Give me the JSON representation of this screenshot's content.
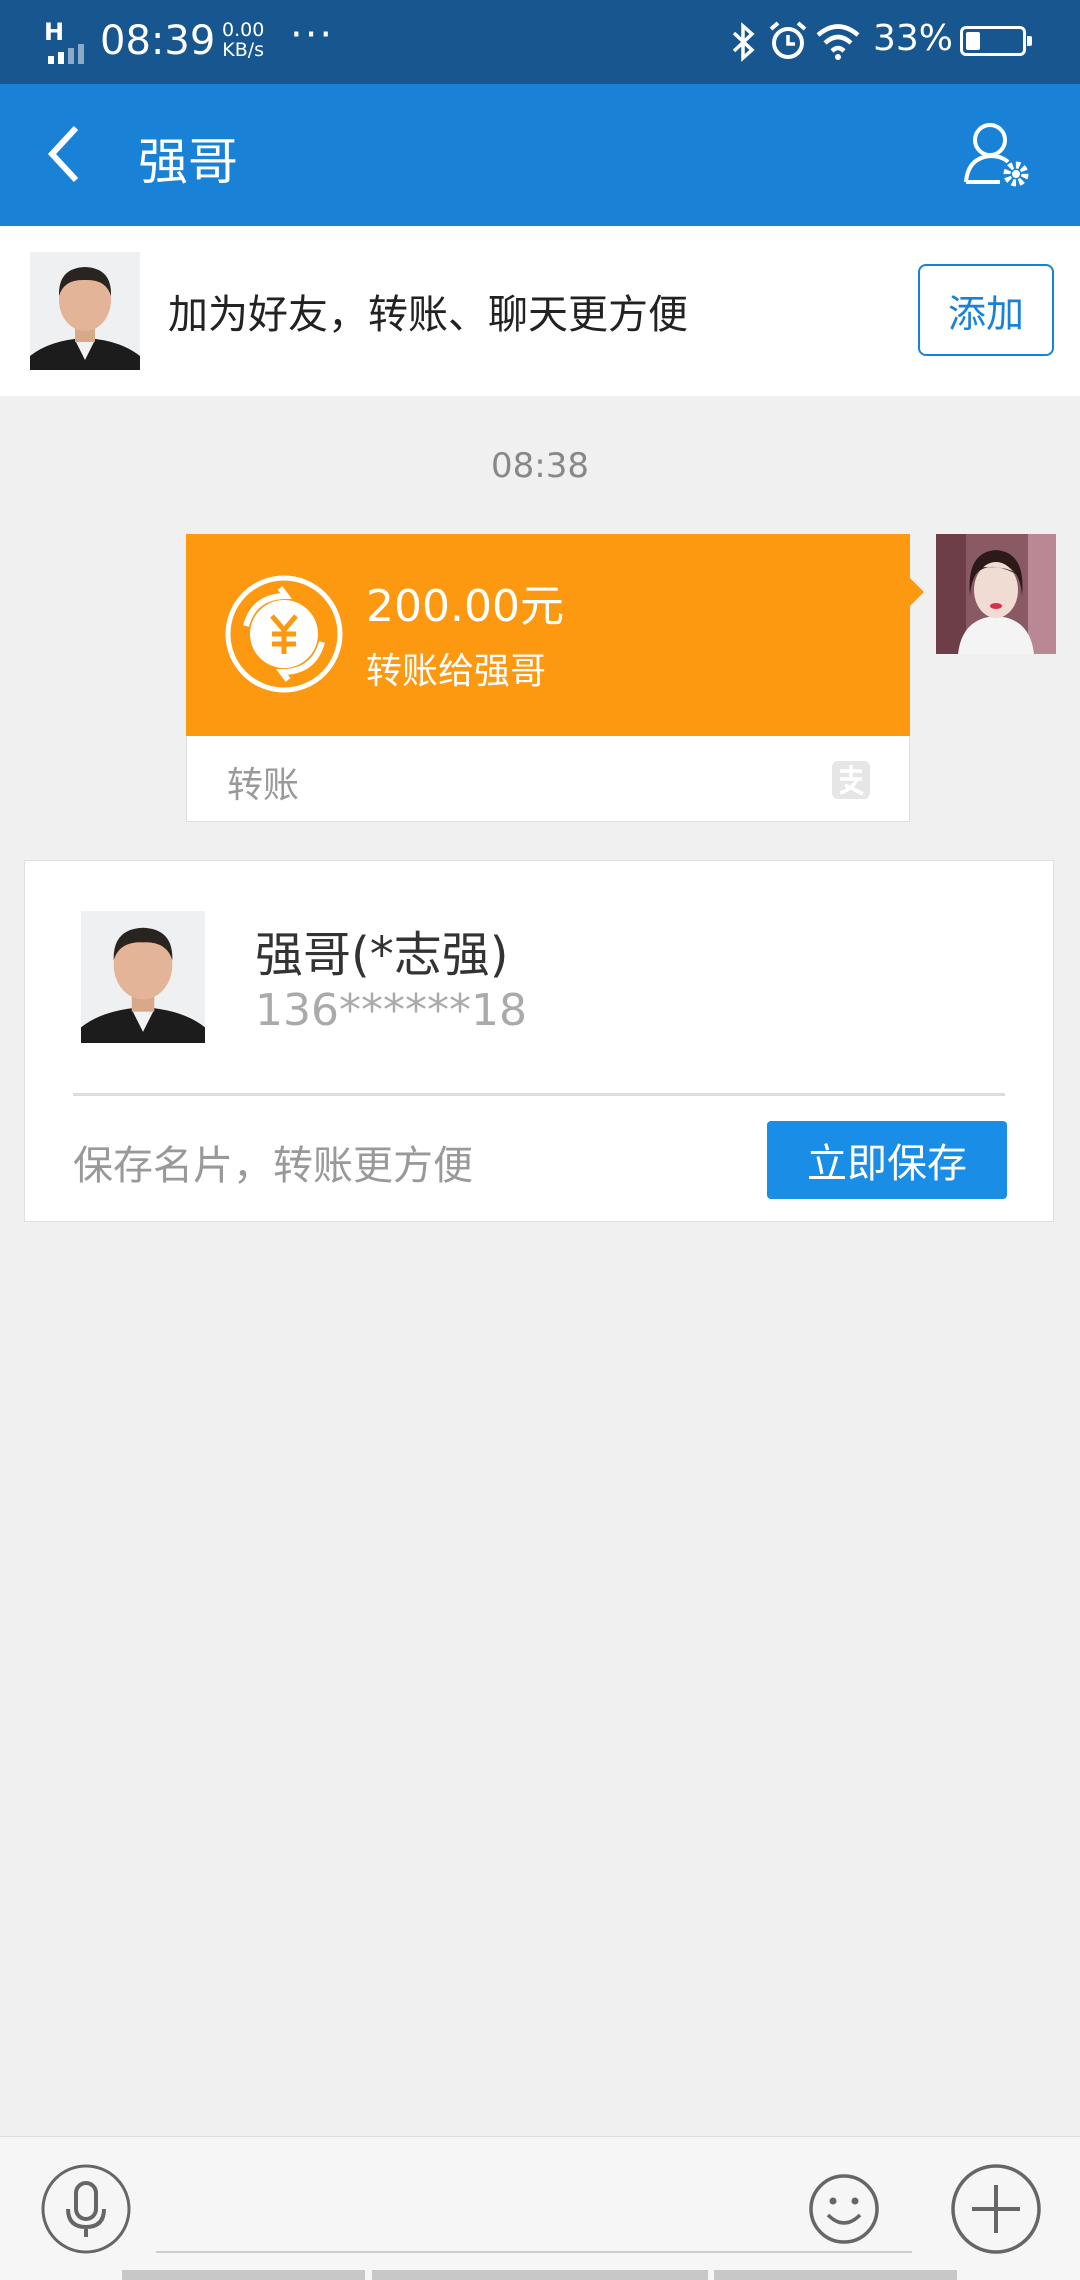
{
  "status_bar": {
    "network_type": "H",
    "time": "08:39",
    "speed_value": "0.00",
    "speed_unit": "KB/s",
    "more": "···",
    "battery_percent": "33%",
    "battery_level": 0.33,
    "icons": [
      "signal-icon",
      "bluetooth-icon",
      "alarm-icon",
      "wifi-icon",
      "battery-icon"
    ]
  },
  "nav": {
    "title": "强哥",
    "back_icon": "chevron-left-icon",
    "settings_icon": "person-settings-icon"
  },
  "add_banner": {
    "prompt": "加为好友，转账、聊天更方便",
    "add_label": "添加"
  },
  "chat": {
    "timestamp": "08:38",
    "transfer": {
      "amount": "200.00元",
      "description": "转账给强哥",
      "type_label": "转账",
      "icon": "yuan-transfer-icon",
      "brand_icon": "alipay-icon"
    }
  },
  "contact_card": {
    "name": "强哥(*志强)",
    "phone": "136******18",
    "hint": "保存名片，转账更方便",
    "save_label": "立即保存"
  },
  "input_bar": {
    "voice_icon": "microphone-icon",
    "emoji_icon": "smiley-icon",
    "plus_icon": "plus-icon"
  },
  "colors": {
    "status_bar": "#17568f",
    "nav_bar": "#1a82d6",
    "transfer": "#fc9910",
    "save_button": "#1a8de6"
  }
}
